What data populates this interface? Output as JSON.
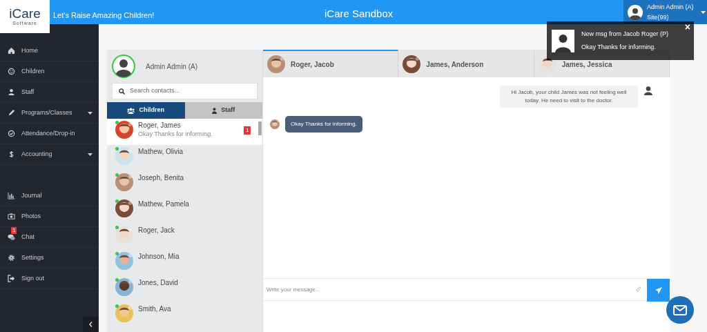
{
  "header": {
    "logo": "iCare",
    "logo_sub": "Software",
    "tagline": "Let's Raise Amazing Children!",
    "title": "iCare Sandbox",
    "user_name": "Admin Admin (A)",
    "user_site": "Site(99)"
  },
  "sidebar": {
    "items": [
      {
        "label": "Home",
        "has_menu": false
      },
      {
        "label": "Children",
        "has_menu": false
      },
      {
        "label": "Staff",
        "has_menu": false
      },
      {
        "label": "Programs/Classes",
        "has_menu": true
      },
      {
        "label": "Attendance/Drop-in",
        "has_menu": false
      },
      {
        "label": "Accounting",
        "has_menu": true
      },
      {
        "label": "Journal",
        "has_menu": false
      },
      {
        "label": "Photos",
        "has_menu": false
      },
      {
        "label": "Chat",
        "has_menu": false,
        "badge": "1"
      },
      {
        "label": "Settings",
        "has_menu": false
      },
      {
        "label": "Sign out",
        "has_menu": false
      }
    ]
  },
  "notification": {
    "title": "New msg from Jacob Roger (P)",
    "text": "Okay Thanks for informing.",
    "close": "×"
  },
  "contacts": {
    "me": "Admin Admin (A)",
    "search_placeholder": "Search contacts...",
    "tabs": [
      {
        "label": "Children",
        "selected": true
      },
      {
        "label": "Staff",
        "selected": false
      }
    ],
    "items": [
      {
        "name": "Roger, James",
        "preview": "Okay Thanks for informing.",
        "unread": "1",
        "online": true,
        "selected": true
      },
      {
        "name": "Mathew, Olivia",
        "online": true,
        "selected": false
      },
      {
        "name": "Joseph, Benita",
        "online": true,
        "selected": false
      },
      {
        "name": "Mathew, Pamela",
        "online": true,
        "selected": false
      },
      {
        "name": "Roger, Jack",
        "online": true,
        "selected": false
      },
      {
        "name": "Johnson, Mia",
        "online": true,
        "selected": false
      },
      {
        "name": "Jones, David",
        "online": true,
        "selected": false
      },
      {
        "name": "Smith, Ava",
        "online": true,
        "selected": false
      }
    ]
  },
  "chat": {
    "tabs": [
      {
        "label": "Roger, Jacob",
        "selected": true
      },
      {
        "label": "James, Anderson",
        "selected": false
      },
      {
        "label": "James, Jessica",
        "selected": false
      }
    ],
    "messages": [
      {
        "kind": "sent",
        "text": "Hi Jacob, your child James was not feeling well today. He need to visit to the doctor."
      },
      {
        "kind": "received",
        "text": "Okay Thanks for informing."
      }
    ],
    "input_placeholder": "Write your message..."
  }
}
